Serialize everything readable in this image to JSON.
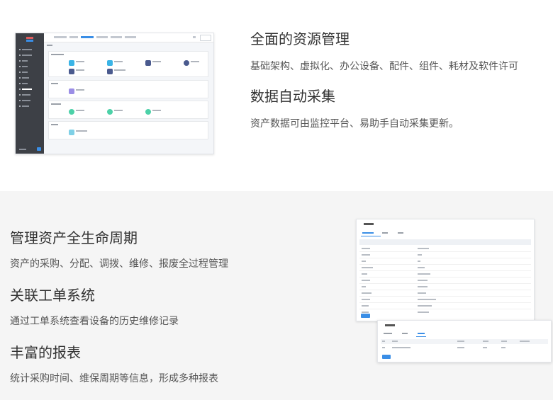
{
  "feature_blocks": [
    {
      "title": "全面的资源管理",
      "desc": "基础架构、虚拟化、办公设备、配件、组件、耗材及软件许可"
    },
    {
      "title": "数据自动采集",
      "desc": "资产数据可由监控平台、易助手自动采集更新。"
    },
    {
      "title": "管理资产全生命周期",
      "desc": "资产的采购、分配、调拨、维修、报废全过程管理"
    },
    {
      "title": "关联工单系统",
      "desc": "通过工单系统查看设备的历史维修记录"
    },
    {
      "title": "丰富的报表",
      "desc": "统计采购时间、维保周期等信息，形成多种报表"
    }
  ],
  "colors": {
    "accent": "#3a8ee6",
    "sidebar": "#3d4046",
    "section_alt_bg": "#f5f5f5",
    "heading": "#333333",
    "body_text": "#555555"
  }
}
